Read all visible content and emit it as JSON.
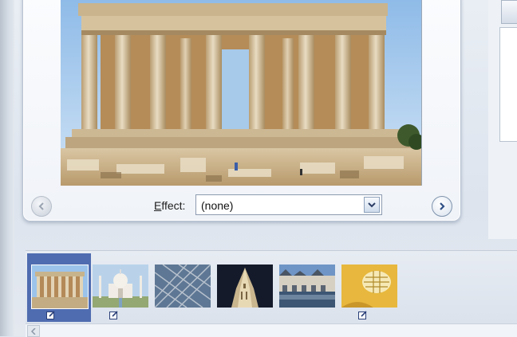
{
  "viewer": {
    "effect_label_prefix": "",
    "effect_label_accel": "E",
    "effect_label_rest": "ffect:",
    "effect_value": "(none)"
  },
  "icons": {
    "prev": "chevron-left-icon",
    "next": "chevron-right-icon",
    "dropdown": "chevron-down-icon",
    "edit": "edit-pencil-icon"
  },
  "colors": {
    "selection": "#4f6cb0",
    "panel_border": "#b8c3d2"
  },
  "filmstrip": {
    "thumbs": [
      {
        "subject": "parthenon",
        "selected": true,
        "edited": true
      },
      {
        "subject": "taj-mahal",
        "selected": false,
        "edited": true
      },
      {
        "subject": "glass-roof-lattice",
        "selected": false,
        "edited": false
      },
      {
        "subject": "night-cathedral-spire",
        "selected": false,
        "edited": false
      },
      {
        "subject": "chateau-chenonceau",
        "selected": false,
        "edited": false
      },
      {
        "subject": "yellow-abstract",
        "selected": false,
        "edited": true
      }
    ]
  }
}
